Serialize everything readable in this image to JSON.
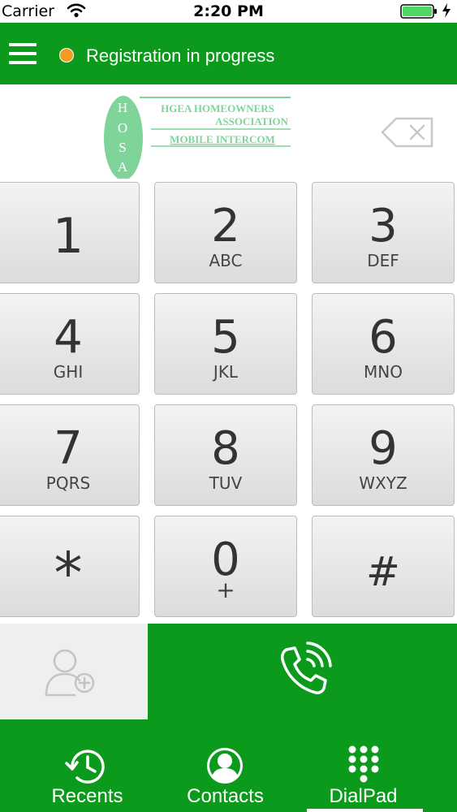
{
  "status_bar": {
    "carrier": "Carrier",
    "time": "2:20 PM"
  },
  "header": {
    "status_text": "Registration in progress",
    "status_color": "#f39c22"
  },
  "logo": {
    "left_letters": [
      "H",
      "O",
      "S",
      "A"
    ],
    "lines": [
      "HGEA HOMEOWNERS",
      "ASSOCIATION",
      "MOBILE INTERCOM"
    ]
  },
  "keypad": {
    "keys": [
      {
        "digit": "1",
        "letters": ""
      },
      {
        "digit": "2",
        "letters": "ABC"
      },
      {
        "digit": "3",
        "letters": "DEF"
      },
      {
        "digit": "4",
        "letters": "GHI"
      },
      {
        "digit": "5",
        "letters": "JKL"
      },
      {
        "digit": "6",
        "letters": "MNO"
      },
      {
        "digit": "7",
        "letters": "PQRS"
      },
      {
        "digit": "8",
        "letters": "TUV"
      },
      {
        "digit": "9",
        "letters": "WXYZ"
      },
      {
        "digit": "*",
        "letters": ""
      },
      {
        "digit": "0",
        "letters": "+"
      },
      {
        "digit": "#",
        "letters": ""
      }
    ]
  },
  "tabs": [
    {
      "label": "Recents",
      "icon": "clock-history-icon"
    },
    {
      "label": "Contacts",
      "icon": "person-circle-icon"
    },
    {
      "label": "DialPad",
      "icon": "dialpad-grid-icon",
      "selected": true
    }
  ],
  "colors": {
    "brand_green": "#0b9a1b",
    "logo_green": "#7fd49a"
  }
}
